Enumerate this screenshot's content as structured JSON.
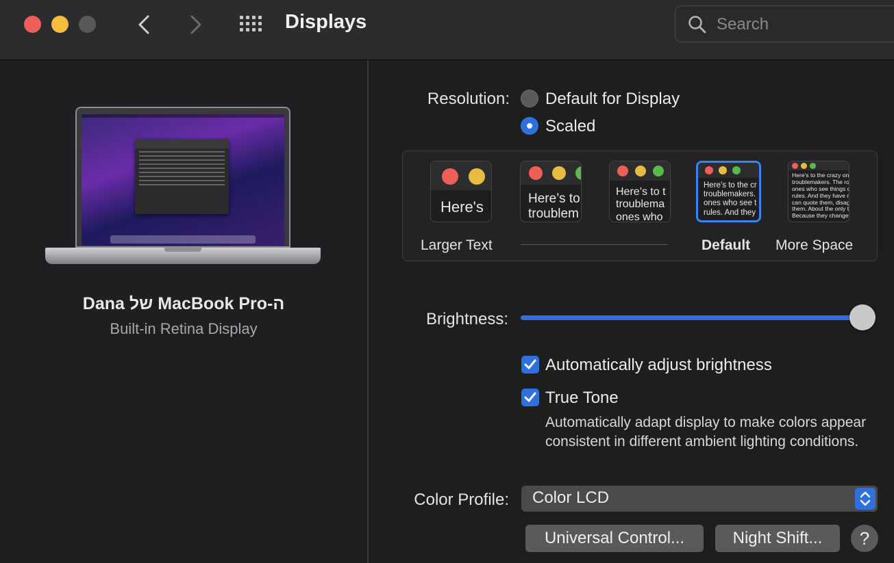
{
  "window": {
    "title": "Displays",
    "search": {
      "placeholder": "Search"
    }
  },
  "device": {
    "name": "Dana של MacBook Pro-ה",
    "subtitle": "Built-in Retina Display"
  },
  "resolution": {
    "label": "Resolution:",
    "options": [
      "Default for Display",
      "Scaled"
    ],
    "selected": "Scaled"
  },
  "scaled": {
    "thumbs": [
      {
        "text": "Here's"
      },
      {
        "text": "Here’s to\ntroublem"
      },
      {
        "text": "Here’s to t\ntroublema\nones who"
      },
      {
        "text": "Here’s to the cr\ntroublemakers.\nones who see t\nrules. And they"
      },
      {
        "text": "Here's to the crazy one\ntroublemakers. The rou\nones who see things dif\nrules. And they have no\ncan quote them, disagr\nthem. About the only th\nBecause they change th"
      }
    ],
    "labels": {
      "larger": "Larger Text",
      "default": "Default",
      "more": "More Space"
    }
  },
  "brightness": {
    "label": "Brightness:",
    "value": 1.0,
    "auto_label": "Automatically adjust brightness",
    "auto_checked": true
  },
  "true_tone": {
    "label": "True Tone",
    "checked": true,
    "description": "Automatically adapt display to make colors appear consistent in different ambient lighting conditions."
  },
  "color_profile": {
    "label": "Color Profile:",
    "value": "Color LCD"
  },
  "buttons": {
    "universal_control": "Universal Control...",
    "night_shift": "Night Shift...",
    "help": "?"
  },
  "colors": {
    "accent": "#2f6fde",
    "close": "#ee5f57",
    "minimize": "#f6bd3b",
    "zoom_disabled": "#58585a"
  }
}
